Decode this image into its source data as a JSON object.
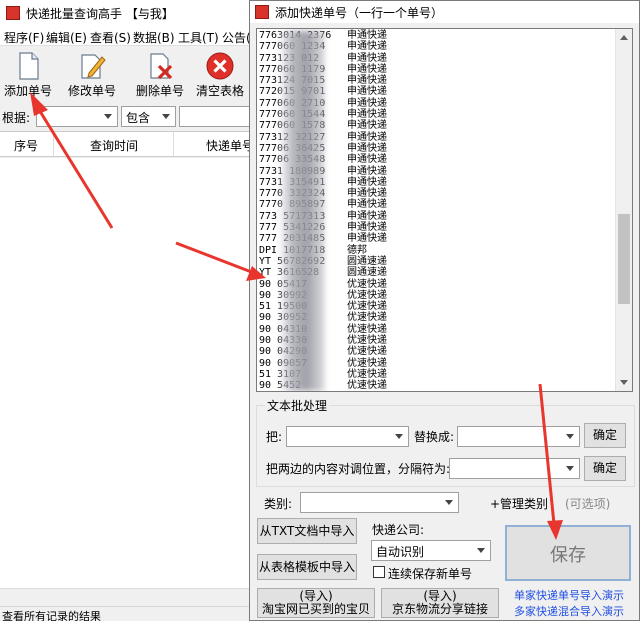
{
  "main_window": {
    "title": "快递批量查询高手 【与我】",
    "menu": [
      "程序(F)",
      "编辑(E)",
      "查看(S)",
      "数据(B)",
      "工具(T)",
      "公告("
    ],
    "toolbar": {
      "add_label": "添加单号",
      "edit_label": "修改单号",
      "delete_label": "删除单号",
      "clear_label": "清空表格"
    },
    "filter": {
      "label": "根据:",
      "field_value": "",
      "mode_value": "包含",
      "search_value": ""
    },
    "grid_columns": [
      "序号",
      "查询时间",
      "快递单号"
    ],
    "status_text": "查看所有记录的结果"
  },
  "dialog": {
    "title": "添加快递单号（一行一个单号）",
    "memo_lines": [
      {
        "num": "7763014  2376",
        "carrier": "申通快递"
      },
      {
        "num": "777060  1234",
        "carrier": "申通快递"
      },
      {
        "num": "773123  012",
        "carrier": "申通快递"
      },
      {
        "num": "777060  1179",
        "carrier": "申通快递"
      },
      {
        "num": "773124  7015",
        "carrier": "申通快递"
      },
      {
        "num": "772015  9701",
        "carrier": "申通快递"
      },
      {
        "num": "777060  2710",
        "carrier": "申通快递"
      },
      {
        "num": "777060  1544",
        "carrier": "申通快递"
      },
      {
        "num": "777060  1578",
        "carrier": "申通快递"
      },
      {
        "num": "77312  32127",
        "carrier": "申通快递"
      },
      {
        "num": "77706  36425",
        "carrier": "申通快递"
      },
      {
        "num": "77706  33548",
        "carrier": "申通快递"
      },
      {
        "num": "7731  180989",
        "carrier": "申通快递"
      },
      {
        "num": "7731  315491",
        "carrier": "申通快递"
      },
      {
        "num": "7770  332324",
        "carrier": "申通快递"
      },
      {
        "num": "7770  895897",
        "carrier": "申通快递"
      },
      {
        "num": "773  5717313",
        "carrier": "申通快递"
      },
      {
        "num": "777  5341226",
        "carrier": "申通快递"
      },
      {
        "num": "777  2031485",
        "carrier": "申通快递"
      },
      {
        "num": "DPI  1017718",
        "carrier": "德邦"
      },
      {
        "num": "YT  56782692",
        "carrier": "圆通速递"
      },
      {
        "num": "YT  3616528",
        "carrier": "圆通速递"
      },
      {
        "num": "90  05417",
        "carrier": "优速快递"
      },
      {
        "num": "90  30992",
        "carrier": "优速快递"
      },
      {
        "num": "51  19500",
        "carrier": "优速快递"
      },
      {
        "num": "90  30952",
        "carrier": "优速快递"
      },
      {
        "num": "90  04310",
        "carrier": "优速快递"
      },
      {
        "num": "90  04330",
        "carrier": "优速快递"
      },
      {
        "num": "90  04290",
        "carrier": "优速快递"
      },
      {
        "num": "90  09057",
        "carrier": "优速快递"
      },
      {
        "num": "51  3107",
        "carrier": "优速快递"
      },
      {
        "num": "90  5452",
        "carrier": "优速快递"
      },
      {
        "num": "90  5432",
        "carrier": "优速快递"
      }
    ],
    "batch_group": "文本批处理",
    "replace_from_label": "把:",
    "replace_to_label": "替换成:",
    "confirm_label": "确定",
    "swap_label": "把两边的内容对调位置，分隔符为:",
    "category_label": "类别:",
    "manage_category_label": "+管理类别",
    "optional_label": "(可选项)",
    "import_txt_label": "从TXT文档中导入",
    "import_sheet_label": "从表格模板中导入",
    "import_taobao_line1": "(导入)",
    "import_taobao_line2": "淘宝网已买到的宝贝",
    "import_jd_line1": "(导入)",
    "import_jd_line2": "京东物流分享链接",
    "carrier_label": "快递公司:",
    "carrier_value": "自动识别",
    "continuous_save_label": "连续保存新单号",
    "save_label": "保存",
    "link_single": "单家快递单号导入演示",
    "link_multi": "多家快递混合导入演示"
  },
  "colors": {
    "annotation_red": "#e8362e",
    "link_blue": "#1f4fe0",
    "save_border": "#8fb1d6"
  }
}
